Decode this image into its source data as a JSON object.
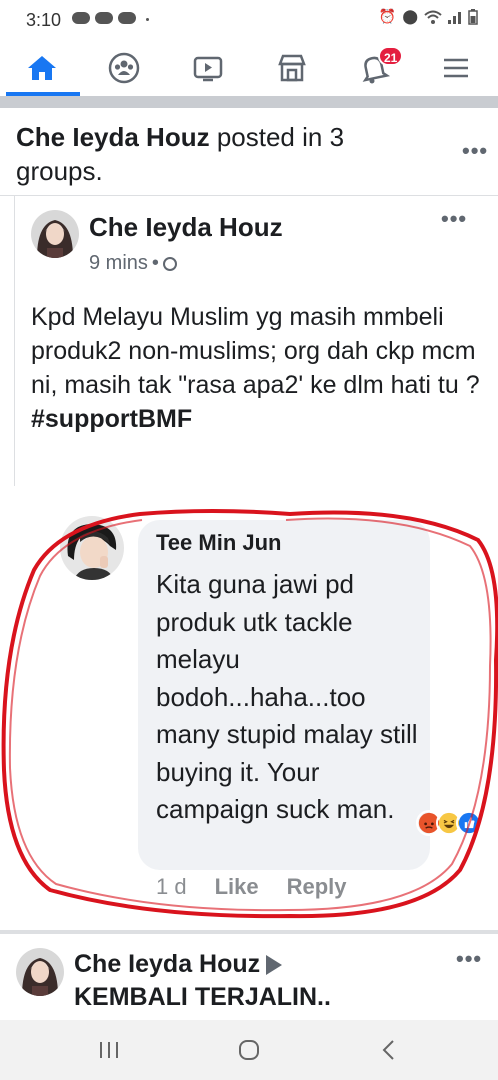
{
  "status_bar": {
    "time": "3:10",
    "right_icons": [
      "alarm-icon",
      "location-icon",
      "wifi-icon",
      "signal-icon",
      "battery-icon"
    ]
  },
  "nav": {
    "items": [
      {
        "name": "home",
        "icon": "home-icon",
        "active": true
      },
      {
        "name": "groups",
        "icon": "groups-icon",
        "active": false
      },
      {
        "name": "watch",
        "icon": "video-icon",
        "active": false
      },
      {
        "name": "marketplace",
        "icon": "shop-icon",
        "active": false
      },
      {
        "name": "notifications",
        "icon": "bell-icon",
        "active": false,
        "badge": "21"
      },
      {
        "name": "menu",
        "icon": "hamburger-icon",
        "active": false
      }
    ],
    "accent": "#1877f2",
    "badge_color": "#e41e3f"
  },
  "post_header": {
    "author": "Che Ieyda Houz",
    "action": " posted in 3 groups."
  },
  "inner_post": {
    "author": "Che Ieyda Houz",
    "time": "9 mins",
    "separator": "•",
    "body": "Kpd Melayu Muslim yg masih mmbeli produk2 non-muslims; org dah ckp mcm ni, masih tak \"rasa apa2' ke dlm hati tu ?",
    "hashtag": "#supportBMF"
  },
  "comment": {
    "author": "Tee Min Jun",
    "text": "Kita guna jawi pd produk utk tackle melayu bodoh...haha...too many stupid malay still buying it. Your campaign suck man.",
    "time": "1 d",
    "like_label": "Like",
    "reply_label": "Reply",
    "reactions": [
      "angry-reaction-icon",
      "haha-reaction-icon",
      "like-reaction-icon"
    ],
    "highlight_color": "#d9131d"
  },
  "next_post": {
    "author": "Che Ieyda Houz",
    "target": "KEMBALI TERJALIN.."
  },
  "system_nav": {
    "buttons": [
      "recent-apps-icon",
      "home-button-icon",
      "back-icon"
    ]
  }
}
